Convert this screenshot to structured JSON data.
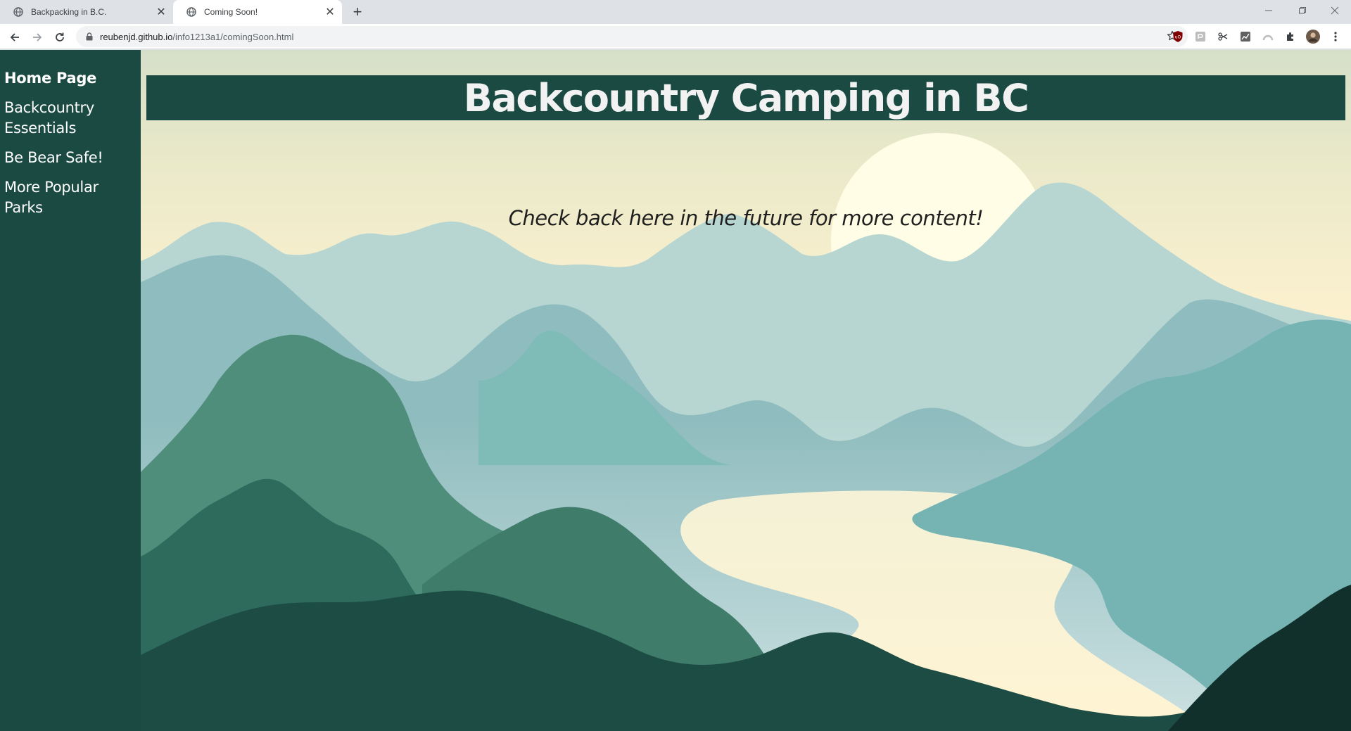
{
  "browser": {
    "tabs": [
      {
        "title": "Backpacking in B.C.",
        "active": false
      },
      {
        "title": "Coming Soon!",
        "active": true
      }
    ],
    "url": {
      "host": "reubenjd.github.io",
      "path": "/info1213a1/comingSoon.html"
    }
  },
  "sidebar": {
    "items": [
      {
        "label": "Home Page",
        "current": true
      },
      {
        "label": "Backcountry Essentials",
        "current": false
      },
      {
        "label": "Be Bear Safe!",
        "current": false
      },
      {
        "label": "More Popular Parks",
        "current": false
      }
    ]
  },
  "header": {
    "title": "Backcountry Camping in BC"
  },
  "main": {
    "notice": "Check back here in the future for more content!"
  },
  "colors": {
    "sidebar_bg": "#1a4a42",
    "header_bg": "#1a4a42",
    "sky_top": "#d6dfc9",
    "sky_bottom": "#fff3d2",
    "sun": "#fffde6"
  }
}
